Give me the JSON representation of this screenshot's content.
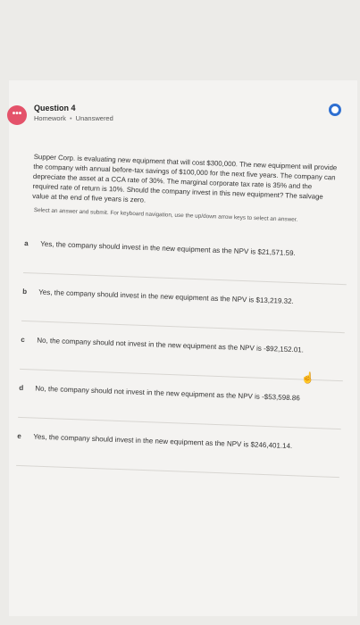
{
  "question": {
    "title": "Question 4",
    "category": "Homework",
    "status": "Unanswered",
    "prompt": "Supper Corp. is evaluating new equipment that will cost $300,000. The new equipment will provide the company with annual before-tax savings of $100,000 for the next five years. The company can depreciate the asset at a CCA rate of 30%. The marginal corporate tax rate is 35% and the required rate of return is 10%. Should the company invest in this new equipment? The salvage value at the end of five years is zero.",
    "instructions": "Select an answer and submit. For keyboard navigation, use the up/down arrow keys to select an answer."
  },
  "options": [
    {
      "letter": "a",
      "text": "Yes, the company should invest in the new equipment as the NPV is $21,571.59."
    },
    {
      "letter": "b",
      "text": "Yes, the company should invest in the new equipment as the NPV is $13,219.32."
    },
    {
      "letter": "c",
      "text": "No, the company should not invest in the new equipment as the NPV is -$92,152.01."
    },
    {
      "letter": "d",
      "text": "No, the company should not invest in the new equipment as the NPV is -$53,598.86"
    },
    {
      "letter": "e",
      "text": "Yes, the company should invest in the new equipment as the NPV is $246,401.14."
    }
  ],
  "icons": {
    "question": "question-bubble-icon",
    "flag": "flag-circle-icon",
    "cursor": "hand-pointer-icon"
  },
  "colors": {
    "accent": "#2e6fd1",
    "question_icon": "#e4526a"
  }
}
